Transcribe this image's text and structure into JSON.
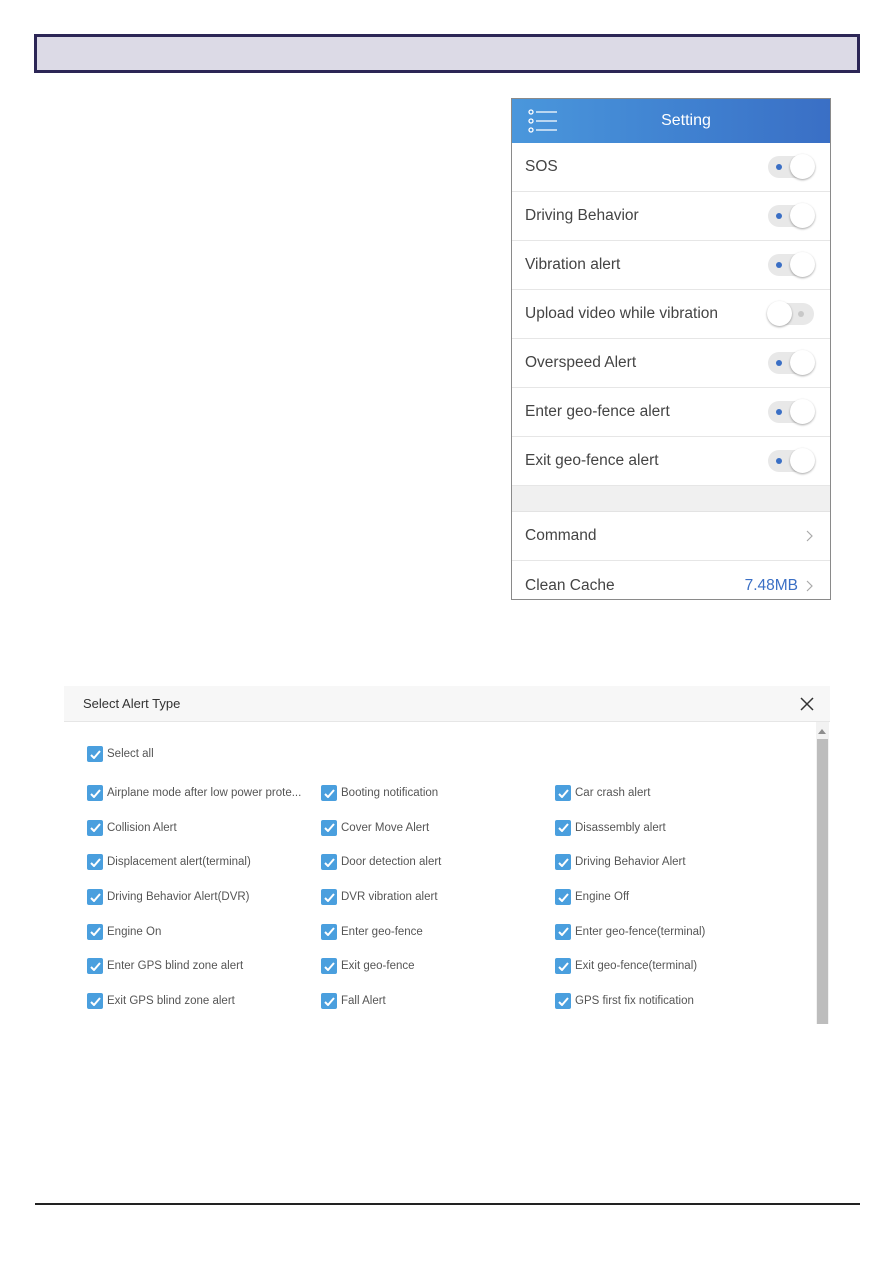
{
  "phone": {
    "title": "Setting",
    "toggles": [
      {
        "label": "SOS",
        "on": true
      },
      {
        "label": "Driving Behavior",
        "on": true
      },
      {
        "label": "Vibration alert",
        "on": true
      },
      {
        "label": "Upload video while vibration",
        "on": false
      },
      {
        "label": "Overspeed Alert",
        "on": true
      },
      {
        "label": "Enter geo-fence alert",
        "on": true
      },
      {
        "label": "Exit geo-fence alert",
        "on": true
      }
    ],
    "command_label": "Command",
    "clean_cache_label": "Clean Cache",
    "cache_size": "7.48MB"
  },
  "dialog": {
    "title": "Select Alert Type",
    "select_all_label": "Select all",
    "select_all_checked": true,
    "alert_types": [
      [
        "Airplane mode after low power prote...",
        "Booting notification",
        "Car crash alert"
      ],
      [
        "Collision Alert",
        "Cover Move Alert",
        "Disassembly alert"
      ],
      [
        "Displacement alert(terminal)",
        "Door detection alert",
        "Driving Behavior Alert"
      ],
      [
        "Driving Behavior Alert(DVR)",
        "DVR vibration alert",
        "Engine Off"
      ],
      [
        "Engine On",
        "Enter geo-fence",
        "Enter geo-fence(terminal)"
      ],
      [
        "Enter GPS blind zone alert",
        "Exit geo-fence",
        "Exit geo-fence(terminal)"
      ],
      [
        "Exit GPS blind zone alert",
        "Fall Alert",
        "GPS first fix notification"
      ]
    ]
  },
  "colors": {
    "accent": "#3a6fc5",
    "checkbox": "#4a9fde",
    "banner_fill": "#dcdae6",
    "banner_border": "#2c2656"
  }
}
